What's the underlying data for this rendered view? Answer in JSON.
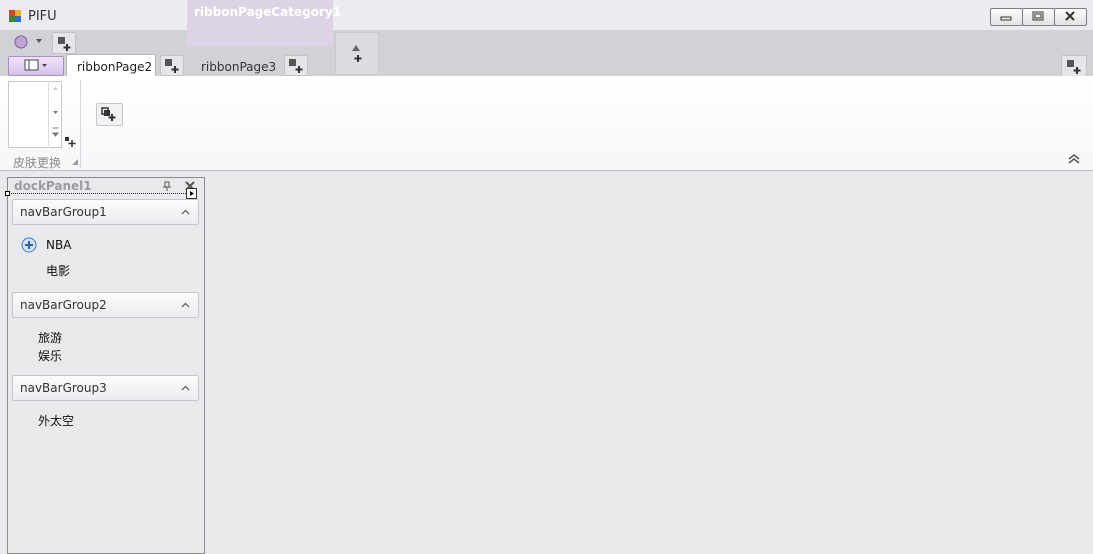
{
  "window": {
    "title": "PIFU"
  },
  "ribbon": {
    "category": "ribbonPageCategory1",
    "tabs": [
      {
        "label": "ribbonPage2",
        "selected": true
      },
      {
        "label": "ribbonPage3",
        "selected": false
      }
    ],
    "group": {
      "caption": "皮肤更换"
    }
  },
  "dock": {
    "caption": "dockPanel1",
    "groups": [
      {
        "label": "navBarGroup1",
        "items": [
          "NBA",
          "电影"
        ]
      },
      {
        "label": "navBarGroup2",
        "items": [
          "旅游",
          "娱乐"
        ]
      },
      {
        "label": "navBarGroup3",
        "items": [
          "外太空"
        ]
      }
    ]
  },
  "icons": {
    "app": "app-icon",
    "add": "add-item-icon",
    "nav_item": "plus-circle-icon"
  },
  "colors": {
    "accent": "#7d5aa8",
    "contextual": "#dcd3e6"
  }
}
